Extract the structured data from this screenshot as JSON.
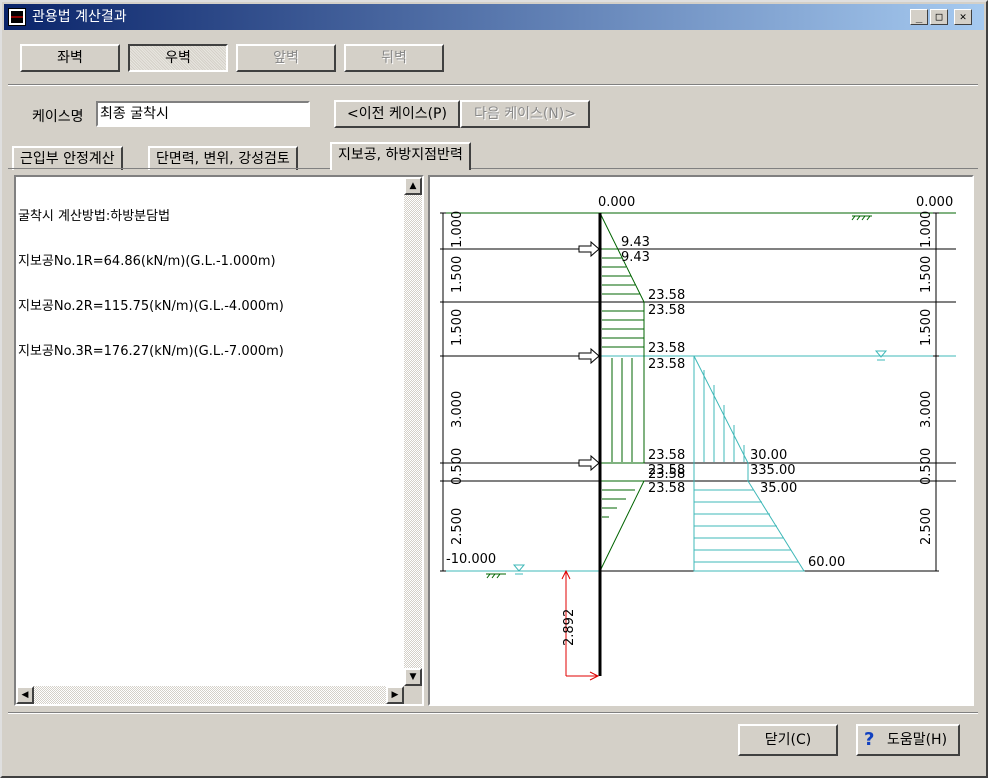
{
  "window": {
    "title": "관용법 계산결과",
    "min_icon": "minimize-icon",
    "max_icon": "maximize-icon",
    "close_icon": "close-icon"
  },
  "walls": [
    "좌벽",
    "우벽",
    "앞벽",
    "뒤벽"
  ],
  "case": {
    "label": "케이스명",
    "value": "최종 굴착시",
    "prev_button": "<이전 케이스(P)",
    "next_button": "다음 케이스(N)>"
  },
  "tabs": [
    "근입부 안정계산",
    "단면력, 변위, 강성검토",
    "지보공, 하방지점반력"
  ],
  "results": [
    "굴착시 계산방법:하방분담법",
    "지보공No.1R=64.86(kN/m)(G.L.-1.000m)",
    "지보공No.2R=115.75(kN/m)(G.L.-4.000m)",
    "지보공No.3R=176.27(kN/m)(G.L.-7.000m)"
  ],
  "diagram": {
    "top_left": "0.000",
    "top_right": "0.000",
    "bottom_level": "-10.000",
    "embed_length": "2.892",
    "layer_dims": [
      "1.000",
      "1.500",
      "1.500",
      "3.000",
      "0.500",
      "2.500"
    ],
    "left_values": [
      "9.43",
      "9.43",
      "23.58",
      "23.58",
      "23.58",
      "23.58",
      "23.58",
      "23.58",
      "23.58",
      "23.58"
    ],
    "right_values": [
      "30.00",
      "35.00",
      "35.00",
      "60.00"
    ],
    "overlap_label": "335.00",
    "colors": {
      "dark_green": "#006400",
      "teal": "#3fb8b8",
      "red": "#e00000"
    }
  },
  "footer": {
    "close_button": "닫기(C)",
    "help_button": "도움말(H)",
    "help_icon": "question-icon"
  }
}
